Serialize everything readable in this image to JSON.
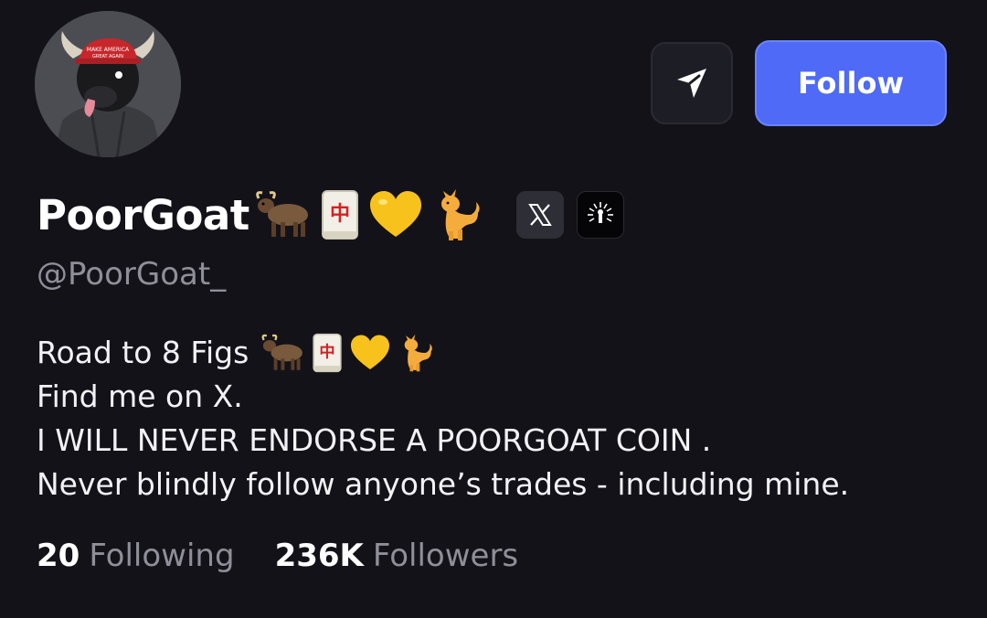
{
  "profile": {
    "display_name": "PoorGoat",
    "name_emojis": [
      "ox-emoji",
      "mahjong-red-dragon-emoji",
      "yellow-heart-emoji",
      "cat-emoji"
    ],
    "handle": "@PoorGoat_",
    "avatar": "bull-avatar-red-cap",
    "socials": [
      "x-logo-icon",
      "linktree-ring-icon"
    ]
  },
  "actions": {
    "share_icon": "send-arrow-icon",
    "follow_label": "Follow"
  },
  "bio": {
    "line1": "Road to 8 Figs",
    "line2": "Find me on X.",
    "line3": "I WILL NEVER ENDORSE A POORGOAT COIN .",
    "line4": "Never blindly follow anyone’s trades - including mine."
  },
  "stats": {
    "following_count": "20",
    "following_label": "Following",
    "followers_count": "236K",
    "followers_label": "Followers"
  },
  "colors": {
    "background": "#141219",
    "accent": "#4e6af7",
    "muted_text": "#8f8f99"
  }
}
